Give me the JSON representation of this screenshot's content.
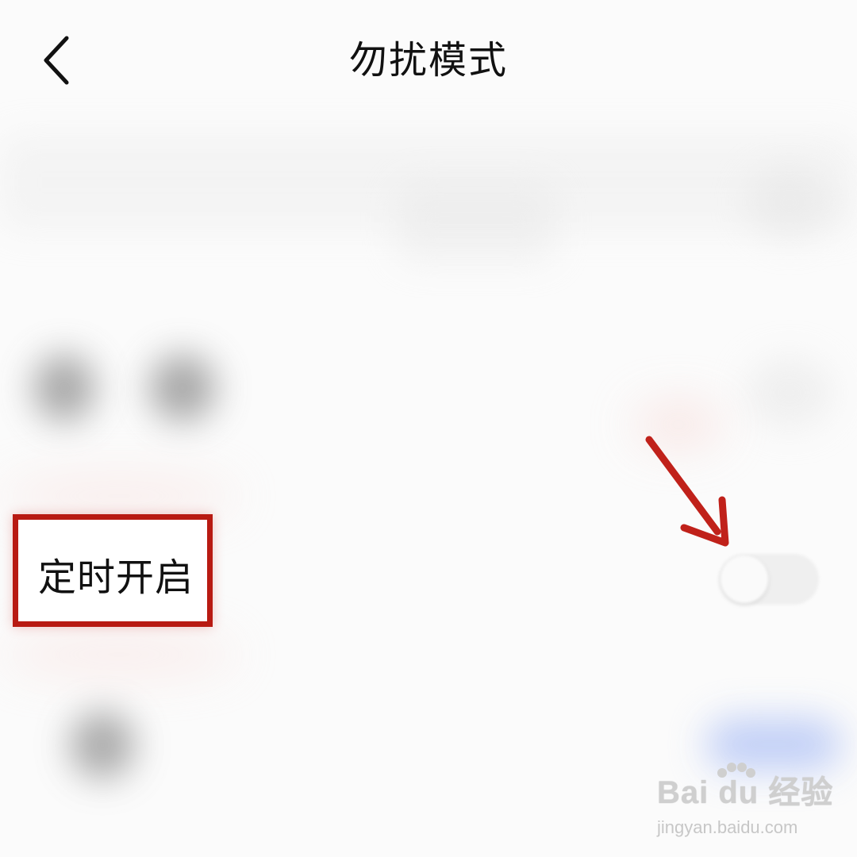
{
  "header": {
    "title": "勿扰模式",
    "back_icon": "chevron-left-icon"
  },
  "row": {
    "label": "定时开启",
    "toggle_state": "off"
  },
  "annotation": {
    "highlight_color": "#b81a12",
    "arrow_color": "#c0211a"
  },
  "watermark": {
    "logo": "Bai du 经验",
    "url": "jingyan.baidu.com"
  },
  "colors": {
    "background": "#fbfbfb",
    "accent_blue": "#b9c9f6"
  }
}
